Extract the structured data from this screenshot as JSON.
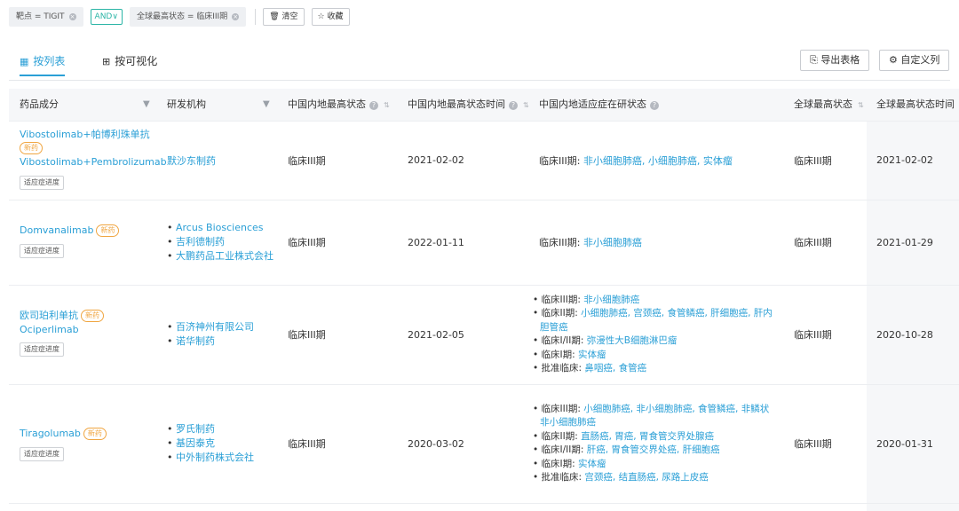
{
  "filters": {
    "target_chip": "靶点 = TIGIT",
    "logic": "AND",
    "status_chip": "全球最高状态 = 临床III期",
    "clear_label": "清空",
    "favorite_label": "收藏"
  },
  "tabs": [
    {
      "label": "按列表"
    },
    {
      "label": "按可视化"
    }
  ],
  "toolbar": {
    "export_label": "导出表格",
    "custom_cols_label": "自定义列"
  },
  "columns": {
    "drug": "药品成分",
    "org": "研发机构",
    "cn_status": "中国内地最高状态",
    "cn_time": "中国内地最高状态时间",
    "cn_indication": "中国内地适应症在研状态",
    "global_status": "全球最高状态",
    "global_time": "全球最高状态时间"
  },
  "labels": {
    "new_tag": "新药",
    "progress_btn": "适应症进度"
  },
  "rows": [
    {
      "drug_cn": "Vibostolimab+帕博利珠单抗",
      "drug_en": "Vibostolimab+Pembrolizumab",
      "orgs": [
        "默沙东制药"
      ],
      "cn_status": "临床III期",
      "cn_time": "2021-02-02",
      "indications": [
        {
          "phase": "临床III期: ",
          "items": "非小细胞肺癌, 小细胞肺癌, 实体瘤"
        }
      ],
      "global_status": "临床III期",
      "global_time": "2021-02-02"
    },
    {
      "drug_cn": "Domvanalimab",
      "orgs": [
        "Arcus Biosciences",
        "吉利德制药",
        "大鹏药品工业株式会社"
      ],
      "cn_status": "临床III期",
      "cn_time": "2022-01-11",
      "indications": [
        {
          "phase": "临床III期: ",
          "items": "非小细胞肺癌"
        }
      ],
      "global_status": "临床III期",
      "global_time": "2021-01-29"
    },
    {
      "drug_cn": "欧司珀利单抗",
      "drug_en": "Ociperlimab",
      "orgs": [
        "百济神州有限公司",
        "诺华制药"
      ],
      "cn_status": "临床III期",
      "cn_time": "2021-02-05",
      "indications": [
        {
          "phase": "临床III期: ",
          "items": "非小细胞肺癌"
        },
        {
          "phase": "临床II期: ",
          "items": "小细胞肺癌, 宫颈癌, 食管鳞癌, 肝细胞癌, 肝内",
          "cont": "胆管癌"
        },
        {
          "phase": "临床I/II期: ",
          "items": "弥漫性大B细胞淋巴瘤"
        },
        {
          "phase": "临床I期: ",
          "items": "实体瘤"
        },
        {
          "phase": "批准临床: ",
          "items": "鼻咽癌, 食管癌"
        }
      ],
      "global_status": "临床III期",
      "global_time": "2020-10-28"
    },
    {
      "drug_cn": "Tiragolumab",
      "orgs": [
        "罗氏制药",
        "基因泰克",
        "中外制药株式会社"
      ],
      "cn_status": "临床III期",
      "cn_time": "2020-03-02",
      "indications": [
        {
          "phase": "临床III期: ",
          "items": "小细胞肺癌, 非小细胞肺癌, 食管鳞癌, 非鳞状",
          "cont": "非小细胞肺癌"
        },
        {
          "phase": "临床II期: ",
          "items": "直肠癌, 胃癌, 胃食管交界处腺癌"
        },
        {
          "phase": "临床I/II期: ",
          "items": "肝癌, 胃食管交界处癌, 肝细胞癌"
        },
        {
          "phase": "临床I期: ",
          "items": "实体瘤"
        },
        {
          "phase": "批准临床: ",
          "items": "宫颈癌, 结直肠癌, 尿路上皮癌"
        }
      ],
      "global_status": "临床III期",
      "global_time": "2020-01-31"
    }
  ]
}
